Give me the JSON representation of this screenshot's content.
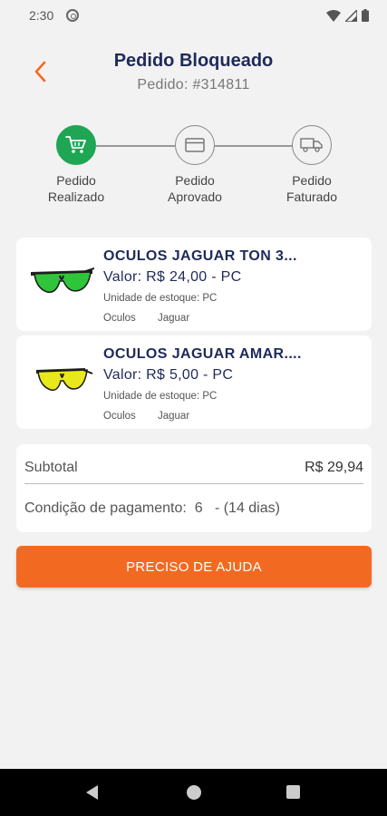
{
  "status_bar": {
    "time": "2:30",
    "icons": [
      "app-notification-icon",
      "wifi-icon",
      "signal-icon",
      "battery-icon"
    ]
  },
  "header": {
    "title": "Pedido Bloqueado",
    "order_number": "Pedido: #314811",
    "back_icon": "chevron-left-icon"
  },
  "steps": [
    {
      "line1": "Pedido",
      "line2": "Realizado",
      "icon": "cart-icon",
      "active": true
    },
    {
      "line1": "Pedido",
      "line2": "Aprovado",
      "icon": "credit-card-icon",
      "active": false
    },
    {
      "line1": "Pedido",
      "line2": "Faturado",
      "icon": "truck-icon",
      "active": false
    }
  ],
  "products": [
    {
      "name": "OCULOS JAGUAR TON 3...",
      "price": "Valor: R$ 24,00 - PC",
      "stock_unit": "Unidade de estoque: PC",
      "category": "Oculos",
      "brand": "Jaguar",
      "lens_color": "#2fc43a"
    },
    {
      "name": "OCULOS JAGUAR AMAR....",
      "price": "Valor: R$ 5,00 - PC",
      "stock_unit": "Unidade de estoque: PC",
      "category": "Oculos",
      "brand": "Jaguar",
      "lens_color": "#e8e81c"
    }
  ],
  "summary": {
    "subtotal_label": "Subtotal",
    "subtotal_value": "R$ 29,94",
    "payment_label": "Condição de pagamento:",
    "payment_value": "6",
    "payment_days": "- (14 dias)"
  },
  "help_button": {
    "label": "PRECISO DE AJUDA"
  },
  "colors": {
    "accent": "#f26a22",
    "success": "#1ea655",
    "title": "#1f2a5a"
  },
  "nav_bar": {
    "icons": [
      "back-triangle-icon",
      "home-circle-icon",
      "recents-square-icon"
    ]
  }
}
